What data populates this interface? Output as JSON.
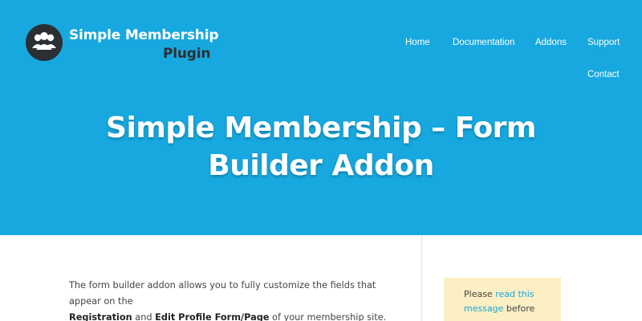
{
  "brand": {
    "line1": "Simple Membership",
    "line2": "Plugin",
    "logo_icon": "users-group-icon"
  },
  "nav": {
    "items": [
      {
        "label": "Home"
      },
      {
        "label": "Documentation"
      },
      {
        "label": "Addons"
      },
      {
        "label": "Support"
      },
      {
        "label": "Contact"
      }
    ]
  },
  "hero": {
    "title": "Simple Membership – Form Builder Addon"
  },
  "content": {
    "intro_1": "The form builder addon allows you to fully customize the fields that appear on the",
    "bold_1": "Registration",
    "mid_1": " and ",
    "bold_2": "Edit Profile Form/Page",
    "tail_1": " of your membership site."
  },
  "notice": {
    "prefix": "Please ",
    "link": "read this message",
    "suffix": " before"
  },
  "colors": {
    "hero_bg": "#17a8df",
    "logo_dark": "#2b2f33",
    "notice_bg": "#fcefc4"
  }
}
